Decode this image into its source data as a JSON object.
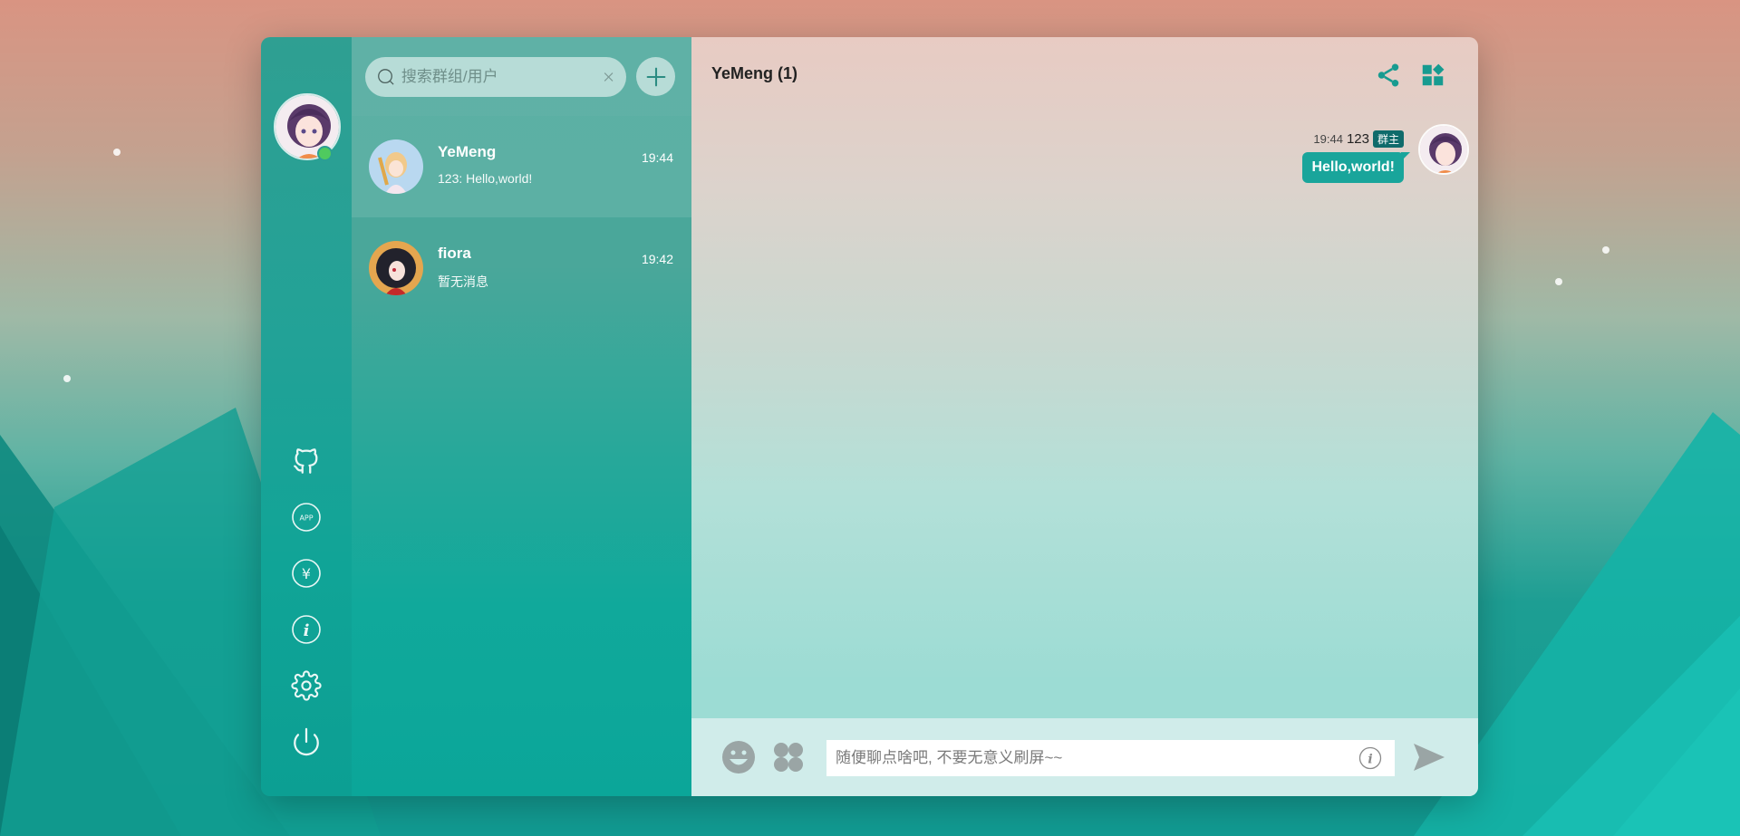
{
  "search": {
    "placeholder": "搜索群组/用户"
  },
  "conversations": [
    {
      "name": "YeMeng",
      "time": "19:44",
      "last": "123: Hello,world!"
    },
    {
      "name": "fiora",
      "time": "19:42",
      "last": "暂无消息"
    }
  ],
  "chat": {
    "title": "YeMeng (1)",
    "messages": [
      {
        "time": "19:44",
        "sender": "123",
        "badge": "群主",
        "text": "Hello,world!"
      }
    ],
    "input_placeholder": "随便聊点啥吧, 不要无意义刷屏~~"
  },
  "rail_icons": [
    "github-icon",
    "app-icon",
    "yuan-icon",
    "info-icon",
    "settings-icon",
    "power-icon"
  ],
  "colors": {
    "accent": "#19a59b",
    "online": "#4fca5f",
    "badge": "#0f6b6b"
  }
}
